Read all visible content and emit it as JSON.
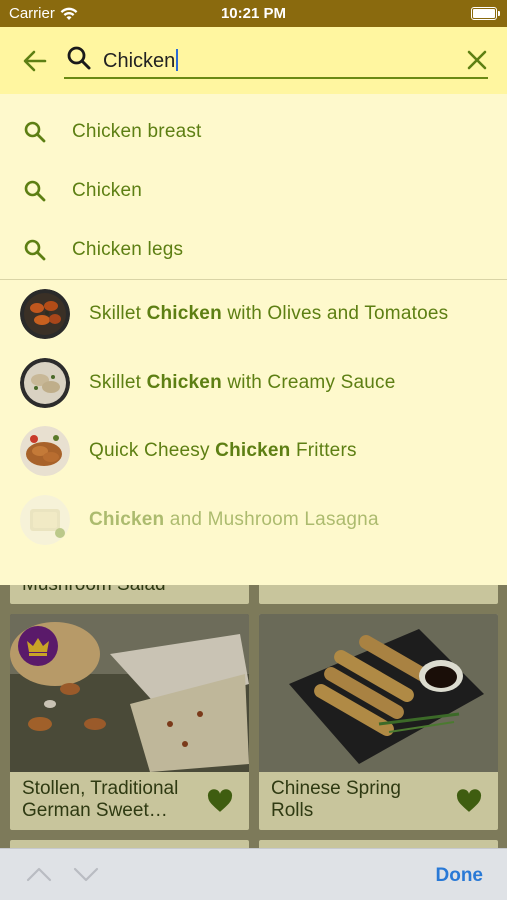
{
  "status_bar": {
    "carrier": "Carrier",
    "time": "10:21 PM",
    "wifi_icon": "wifi-icon",
    "battery_icon": "battery-icon"
  },
  "search": {
    "query": "Chicken",
    "back_icon": "arrow-left-icon",
    "search_icon": "search-icon",
    "clear_icon": "close-icon"
  },
  "suggestions": [
    {
      "label": "Chicken breast"
    },
    {
      "label": "Chicken"
    },
    {
      "label": "Chicken legs"
    }
  ],
  "recipe_results": [
    {
      "pre": "Skillet ",
      "match": "Chicken",
      "post": " with Olives and Tomatoes"
    },
    {
      "pre": "Skillet ",
      "match": "Chicken",
      "post": " with Creamy Sauce"
    },
    {
      "pre": "Quick Cheesy ",
      "match": "Chicken",
      "post": " Fritters"
    },
    {
      "pre": "",
      "match": "Chicken",
      "post": " and Mushroom Lasagna"
    }
  ],
  "background_cards": {
    "partial_label": "Mushroom Salad",
    "cards": [
      {
        "name": "Stollen, Traditional German Sweet…",
        "premium": true
      },
      {
        "name": "Chinese Spring Rolls",
        "premium": false
      }
    ]
  },
  "keyboard_toolbar": {
    "done_label": "Done",
    "prev_icon": "chevron-up-icon",
    "next_icon": "chevron-down-icon"
  },
  "colors": {
    "accent_green": "#5d7f13",
    "header_yellow": "#fff6a0",
    "panel_yellow": "#fef9cc",
    "status_bar": "#8a6a0e",
    "done_blue": "#2979d6"
  }
}
